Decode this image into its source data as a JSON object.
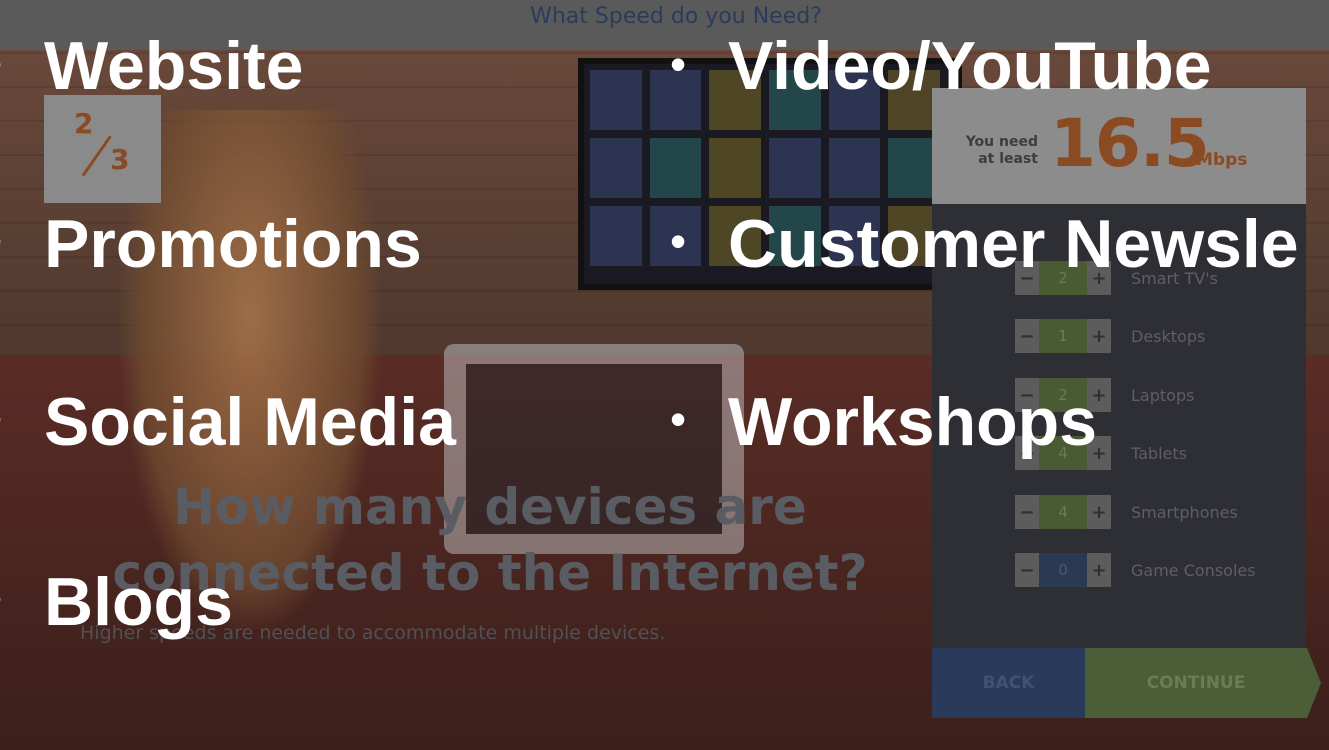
{
  "background_app": {
    "title": "What Speed do you Need?",
    "step": {
      "numerator": "2",
      "denominator": "3"
    },
    "speed": {
      "label": "You need\nat least",
      "value": "16.5",
      "unit": "Mbps"
    },
    "devices": [
      {
        "name": "Smart TV's",
        "count": "2"
      },
      {
        "name": "Desktops",
        "count": "1"
      },
      {
        "name": "Laptops",
        "count": "2"
      },
      {
        "name": "Tablets",
        "count": "4"
      },
      {
        "name": "Smartphones",
        "count": "4"
      },
      {
        "name": "Game Consoles",
        "count": "0"
      }
    ],
    "minus_symbol": "−",
    "plus_symbol": "+",
    "question": "How many devices are\nconnected to the Internet?",
    "subtext": "Higher speeds are needed to accommodate multiple devices.",
    "buttons": {
      "back": "BACK",
      "continue": "CONTINUE"
    },
    "colors": {
      "accent_orange": "#d9691f",
      "back_blue": "#3b5a9a",
      "continue_green": "#7aa441"
    }
  },
  "overlay": {
    "bullet_symbol": "•",
    "left_column": [
      "Website",
      "Promotions",
      "Social Media",
      "Blogs"
    ],
    "right_column": [
      "Video/YouTube",
      "Customer Newsle"
    ]
  },
  "overlay_extra": {
    "right_column_3": "Workshops"
  }
}
